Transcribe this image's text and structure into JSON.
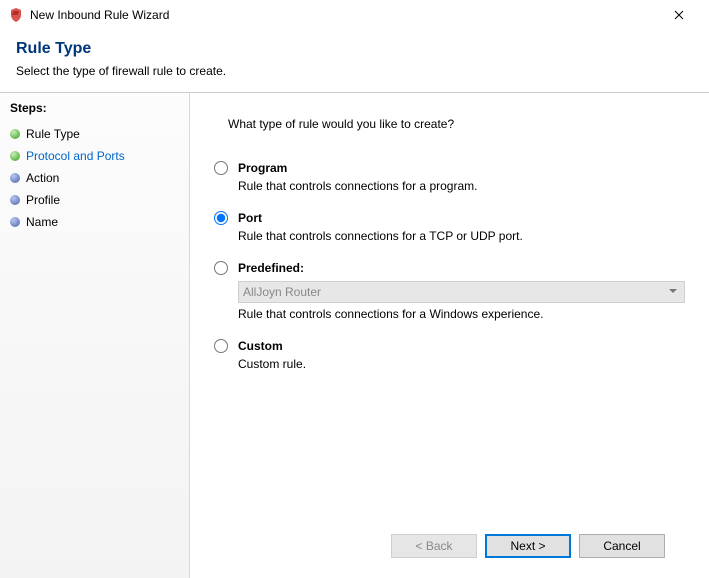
{
  "window": {
    "title": "New Inbound Rule Wizard"
  },
  "header": {
    "title": "Rule Type",
    "subtitle": "Select the type of firewall rule to create."
  },
  "sidebar": {
    "title": "Steps:",
    "items": [
      {
        "label": "Rule Type",
        "active": true,
        "link": false
      },
      {
        "label": "Protocol and Ports",
        "active": true,
        "link": true
      },
      {
        "label": "Action",
        "active": false,
        "link": false
      },
      {
        "label": "Profile",
        "active": false,
        "link": false
      },
      {
        "label": "Name",
        "active": false,
        "link": false
      }
    ]
  },
  "content": {
    "question": "What type of rule would you like to create?",
    "options": [
      {
        "id": "program",
        "label": "Program",
        "desc": "Rule that controls connections for a program.",
        "selected": false
      },
      {
        "id": "port",
        "label": "Port",
        "desc": "Rule that controls connections for a TCP or UDP port.",
        "selected": true
      },
      {
        "id": "predefined",
        "label": "Predefined:",
        "desc": "Rule that controls connections for a Windows experience.",
        "selected": false,
        "dropdown_value": "AllJoyn Router",
        "dropdown_disabled": true
      },
      {
        "id": "custom",
        "label": "Custom",
        "desc": "Custom rule.",
        "selected": false
      }
    ]
  },
  "footer": {
    "back": "< Back",
    "next": "Next >",
    "cancel": "Cancel"
  }
}
